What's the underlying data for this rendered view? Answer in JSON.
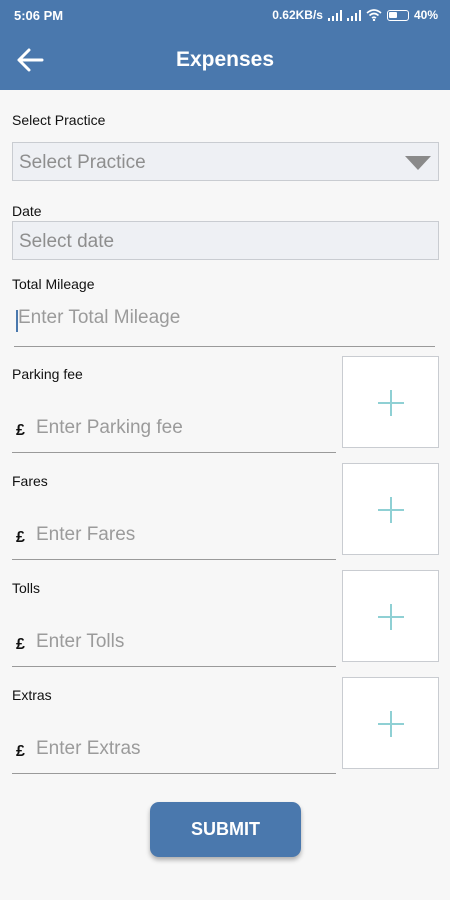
{
  "status_bar": {
    "time": "5:06 PM",
    "network_speed": "0.62KB/s",
    "battery": "40%"
  },
  "app_bar": {
    "title": "Expenses",
    "back_icon": "arrow-left-icon"
  },
  "form": {
    "practice": {
      "label": "Select Practice",
      "placeholder": "Select Practice"
    },
    "date": {
      "label": "Date",
      "placeholder": "Select date"
    },
    "mileage": {
      "label": "Total Mileage",
      "placeholder": "Enter Total Mileage"
    },
    "currency_symbol": "£",
    "fees": [
      {
        "label": "Parking fee",
        "placeholder": "Enter Parking fee"
      },
      {
        "label": "Fares",
        "placeholder": "Enter Fares"
      },
      {
        "label": "Tolls",
        "placeholder": "Enter Tolls"
      },
      {
        "label": "Extras",
        "placeholder": "Enter Extras"
      }
    ],
    "submit_label": "SUBMIT"
  },
  "colors": {
    "primary": "#4a78ad",
    "plus_icon": "#8fd0d4"
  }
}
